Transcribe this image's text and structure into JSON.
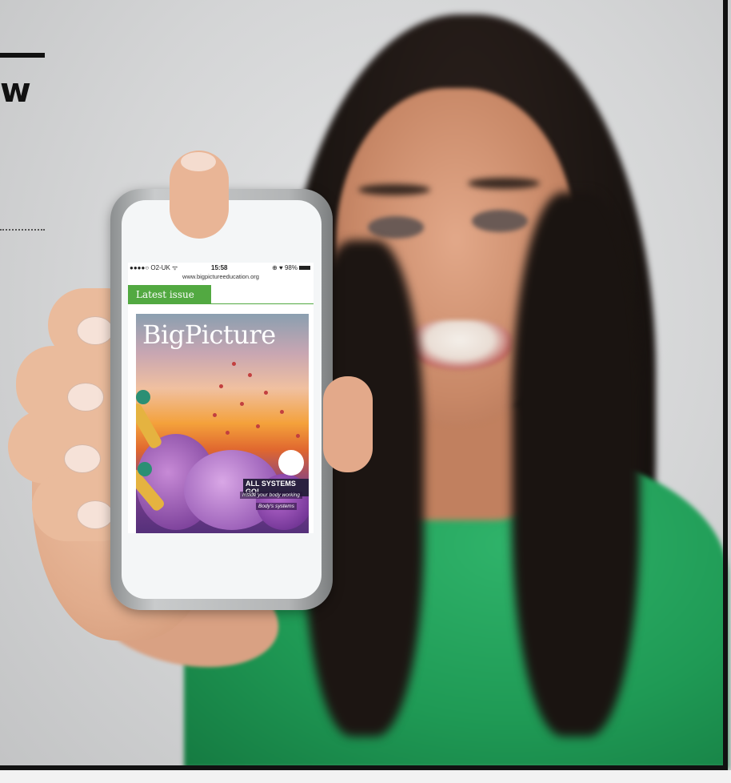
{
  "page": {
    "heading_fragment": "w"
  },
  "phone": {
    "status_bar": {
      "carrier": "●●●●○ O2-UK ᯤ",
      "time": "15:58",
      "battery": "⊕ ♥ 98%"
    },
    "url": "www.bigpictureeducation.org",
    "tab_label": "Latest issue",
    "cover": {
      "title": "BigPicture",
      "headline": "ALL SYSTEMS GO!",
      "sub1": "Inside your body working",
      "sub2": "Body's systems"
    }
  },
  "colors": {
    "tab_green": "#52a941",
    "shirt_green": "#1f9a55",
    "frame": "#111111"
  }
}
